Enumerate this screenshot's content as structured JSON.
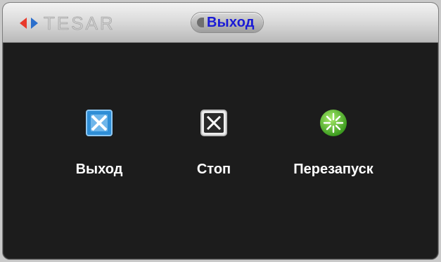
{
  "brand": {
    "name": "TESAR"
  },
  "dialog": {
    "title": "Выход"
  },
  "actions": [
    {
      "label": "Выход",
      "icon": "logout-icon"
    },
    {
      "label": "Стоп",
      "icon": "stop-icon"
    },
    {
      "label": "Перезапуск",
      "icon": "restart-icon"
    }
  ],
  "colors": {
    "title_text": "#1a1ad6",
    "background": "#1c1c1c",
    "exit_icon": "#2f8ed6",
    "restart_icon": "#58c12e"
  }
}
